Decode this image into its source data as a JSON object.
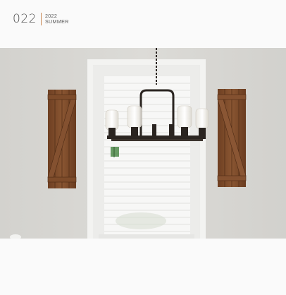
{
  "header": {
    "page_number": "022",
    "year": "2022",
    "season": "SUMMER"
  },
  "photo": {
    "subject": "chandelier-window-shutters"
  },
  "colors": {
    "accent_separator": "#c98a55",
    "text": "#4a4a4a",
    "wall": "#d6d5d1",
    "wood": "#7a4a2a"
  }
}
